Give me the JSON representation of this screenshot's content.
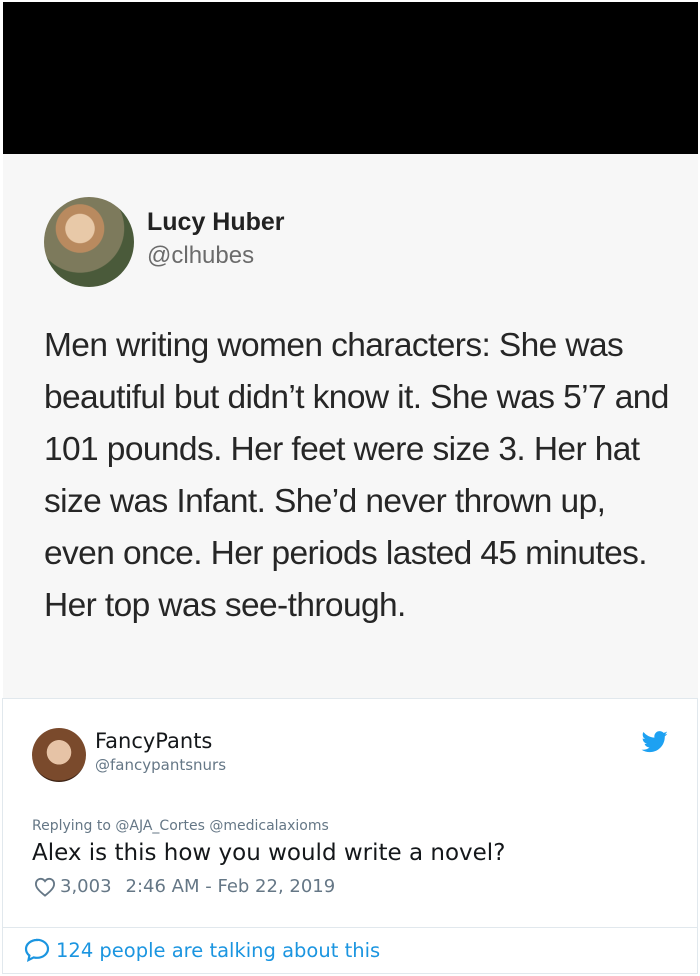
{
  "embedded_tweet": {
    "name": "Lucy Huber",
    "handle": "@clhubes",
    "text": "Men writing women characters: She was beautiful but didn’t know it. She was 5’7 and 101 pounds. Her feet were size 3. Her hat size was Infant. She’d never thrown up, even once. Her periods lasted 45 minutes. Her top was see-through."
  },
  "tweet": {
    "name": "FancyPants",
    "handle": "@fancypantsnurs",
    "replying_to": "Replying to @AJA_Cortes @medicalaxioms",
    "text": "Alex is this how you would write a novel?",
    "likes": "3,003",
    "timestamp": "2:46 AM - Feb 22, 2019",
    "talking": "124 people are talking about this"
  },
  "colors": {
    "twitter_blue": "#1b95e0",
    "muted": "#657786"
  },
  "icons": [
    "twitter-bird-icon",
    "heart-icon",
    "speech-bubble-icon"
  ]
}
